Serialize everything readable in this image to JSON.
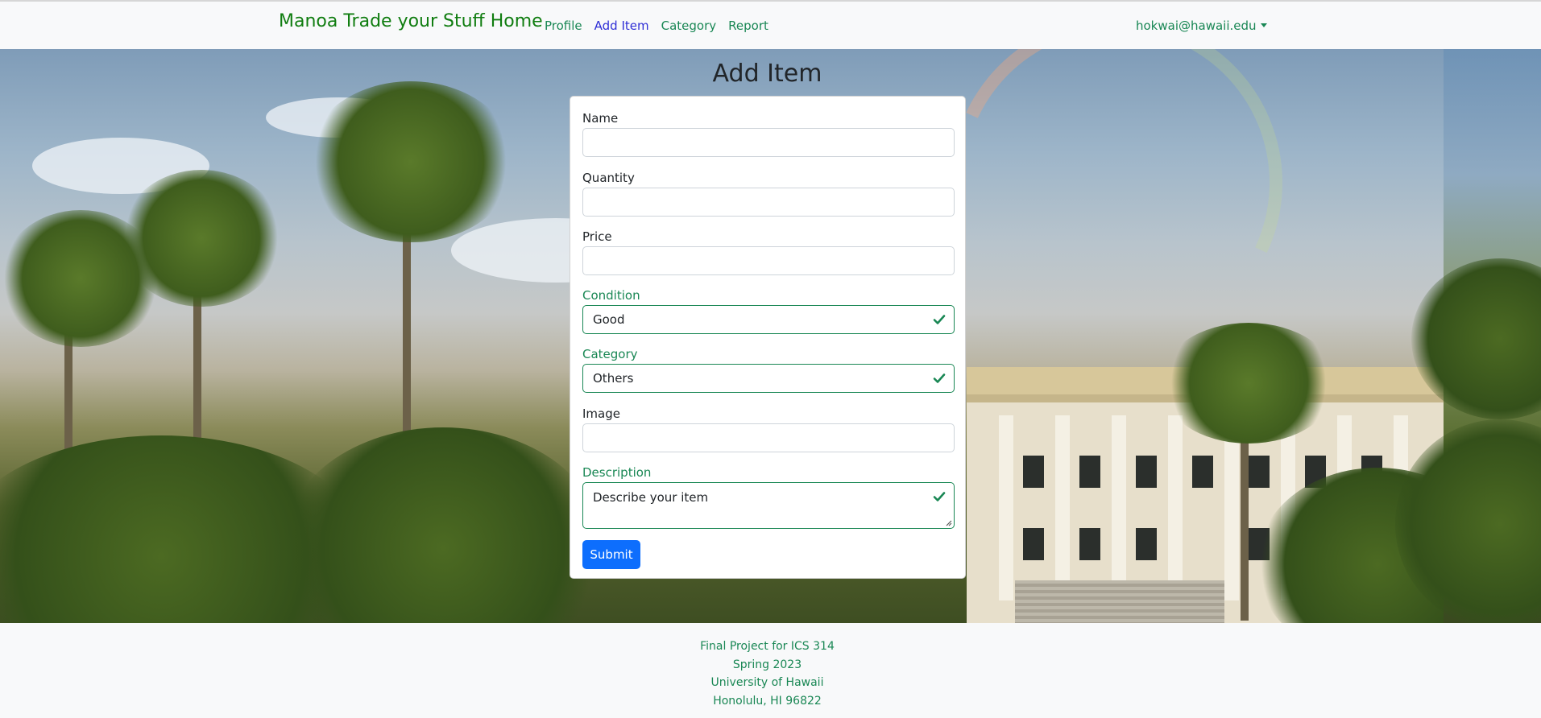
{
  "navbar": {
    "brand": "Manoa Trade your Stuff Home",
    "links": [
      "Profile",
      "Add Item",
      "Category",
      "Report"
    ],
    "active_link": "Add Item",
    "user": "hokwai@hawaii.edu"
  },
  "page": {
    "title": "Add Item"
  },
  "form": {
    "name": {
      "label": "Name",
      "value": ""
    },
    "quantity": {
      "label": "Quantity",
      "value": ""
    },
    "price": {
      "label": "Price",
      "value": ""
    },
    "condition": {
      "label": "Condition",
      "value": "Good"
    },
    "category": {
      "label": "Category",
      "value": "Others"
    },
    "image": {
      "label": "Image",
      "value": ""
    },
    "description": {
      "label": "Description",
      "value": "Describe your item"
    },
    "submit_label": "Submit"
  },
  "footer": {
    "lines": [
      "Final Project for ICS 314",
      "Spring 2023",
      "University of Hawaii",
      "Honolulu, HI 96822"
    ]
  },
  "colors": {
    "brand_green": "#107d10",
    "valid_green": "#198754",
    "primary_blue": "#0d6efd",
    "active_link": "#2f2fd6"
  },
  "icons": {
    "valid": "check-icon",
    "dropdown": "caret-down-icon"
  }
}
